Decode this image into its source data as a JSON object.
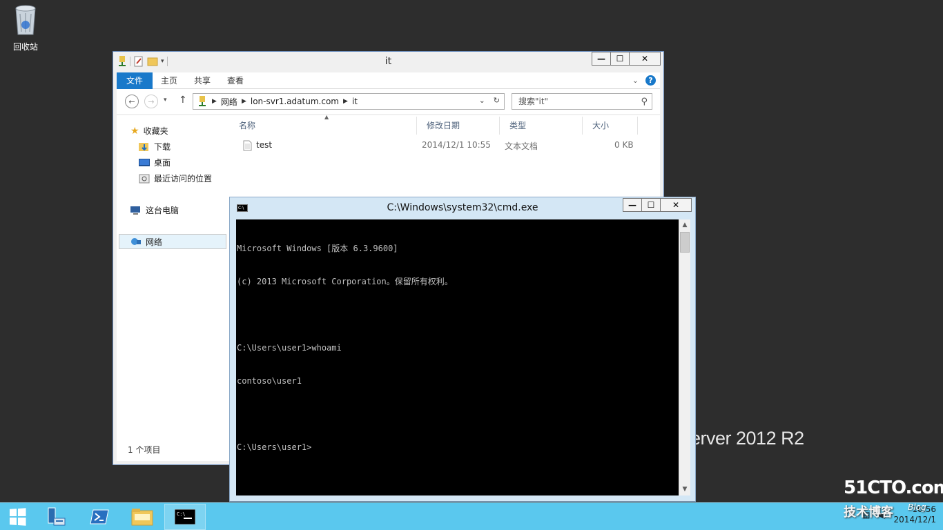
{
  "desktop": {
    "recycle_bin_label": "回收站",
    "server_watermark": "erver 2012 R2"
  },
  "explorer": {
    "title": "it",
    "ribbon_tabs": [
      {
        "label": "文件",
        "active": true
      },
      {
        "label": "主页"
      },
      {
        "label": "共享"
      },
      {
        "label": "查看"
      }
    ],
    "address_segments": [
      "网络",
      "lon-svr1.adatum.com",
      "it"
    ],
    "search_placeholder": "搜索\"it\"",
    "nav": {
      "favorites": "收藏夹",
      "downloads": "下载",
      "desktop": "桌面",
      "recent": "最近访问的位置",
      "this_pc": "这台电脑",
      "network": "网络"
    },
    "columns": [
      "名称",
      "修改日期",
      "类型",
      "大小"
    ],
    "files": [
      {
        "name": "test",
        "modified": "2014/12/1 10:55",
        "type": "文本文档",
        "size": "0 KB"
      }
    ],
    "status": "1 个项目"
  },
  "cmd": {
    "title": "C:\\Windows\\system32\\cmd.exe",
    "lines": [
      "Microsoft Windows [版本 6.3.9600]",
      "(c) 2013 Microsoft Corporation。保留所有权利。",
      "",
      "C:\\Users\\user1>whoami",
      "contoso\\user1",
      "",
      "C:\\Users\\user1>"
    ]
  },
  "window_buttons": {
    "minimize": "—",
    "maximize": "☐",
    "close": "✕"
  },
  "taskbar": {
    "clock_time": "10:56",
    "clock_date": "2014/12/1"
  },
  "watermark": {
    "site": "51CTO.com",
    "sub": "技术博客",
    "blog": "Blog"
  },
  "colors": {
    "taskbar": "#5ac8ee",
    "ribbon_file_tab": "#1979ca",
    "desktop": "#2d2d2d"
  }
}
